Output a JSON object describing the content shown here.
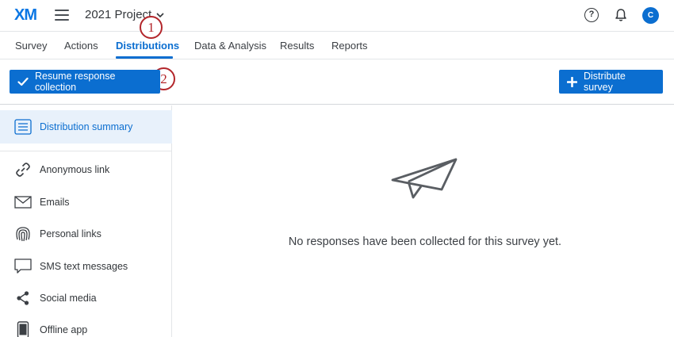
{
  "header": {
    "logo": "XM",
    "project_title": "2021 Project",
    "help_glyph": "?",
    "avatar_initial": "C"
  },
  "tabs": [
    {
      "label": "Survey"
    },
    {
      "label": "Actions"
    },
    {
      "label": "Distributions",
      "active": true
    },
    {
      "label": "Data & Analysis"
    },
    {
      "label": "Results"
    },
    {
      "label": "Reports"
    }
  ],
  "callouts": [
    "1",
    "2"
  ],
  "actionbar": {
    "resume_label": "Resume response collection",
    "distribute_label": "Distribute survey"
  },
  "sidebar": {
    "summary_label": "Distribution summary",
    "items": [
      {
        "label": "Anonymous link",
        "icon": "link-icon"
      },
      {
        "label": "Emails",
        "icon": "envelope-icon"
      },
      {
        "label": "Personal links",
        "icon": "fingerprint-icon"
      },
      {
        "label": "SMS text messages",
        "icon": "chat-bubble-icon"
      },
      {
        "label": "Social media",
        "icon": "share-icon"
      },
      {
        "label": "Offline app",
        "icon": "mobile-device-icon"
      }
    ]
  },
  "main": {
    "empty_message": "No responses have been collected for this survey yet."
  },
  "colors": {
    "brand_blue": "#0b6ed0",
    "callout_red": "#b3262b"
  }
}
